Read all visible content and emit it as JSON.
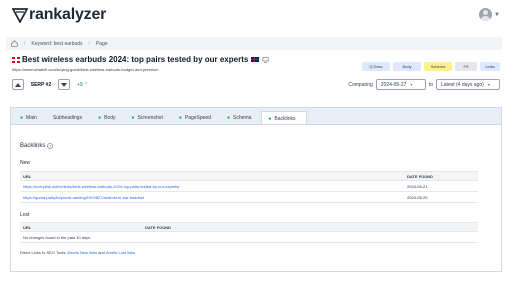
{
  "app": {
    "name": "rankalyzer"
  },
  "breadcrumb": {
    "items": [
      "Keyword: best earbuds",
      "Page"
    ]
  },
  "page": {
    "title": "Best wireless earbuds 2024: top pairs tested by our experts",
    "url": "https://www.whathifi.com/buying-guide/best-wireless-earbuds-budget-and-premium"
  },
  "tags": [
    {
      "label": "Q Desc"
    },
    {
      "label": "Body"
    },
    {
      "label": "Schema"
    },
    {
      "label": "FS"
    },
    {
      "label": "Links"
    }
  ],
  "serp": {
    "label": "SERP #2",
    "rank_change": "+9"
  },
  "compare": {
    "label": "Comparing",
    "from": "2024-05-27",
    "to_word": "to",
    "to": "Latest (4 days ago)"
  },
  "tabs": [
    {
      "label": "Main",
      "dot": true
    },
    {
      "label": "Subheadings",
      "dot": false
    },
    {
      "label": "Body",
      "dot": true
    },
    {
      "label": "Screenshot",
      "dot": true
    },
    {
      "label": "PageSpeed",
      "dot": true
    },
    {
      "label": "Schema",
      "dot": true
    },
    {
      "label": "Backlinks",
      "dot": true,
      "active": true
    }
  ],
  "backlinks": {
    "heading": "Backlinks",
    "new_heading": "New",
    "new_columns": [
      "URL",
      "DATE FOUND"
    ],
    "new_rows": [
      {
        "url": "https://everylink.online/links/best-wireless-earbuds-2024-top-pairs-tested-by-our-experts/",
        "date": "2024-05-21"
      },
      {
        "url": "https://quora.party/keyword-ranking/1929827/android-in-ear-headset",
        "date": "2024-05-20"
      }
    ],
    "lost_heading": "Lost",
    "lost_columns": [
      "URL",
      "DATE FOUND"
    ],
    "lost_empty": "No changes found in the past 30 days.",
    "direct_prefix": "Direct Links to SEO Tools:",
    "direct_new": "Ahrefs New links",
    "direct_and": "and",
    "direct_lost": "Ahrefs Lost links"
  }
}
